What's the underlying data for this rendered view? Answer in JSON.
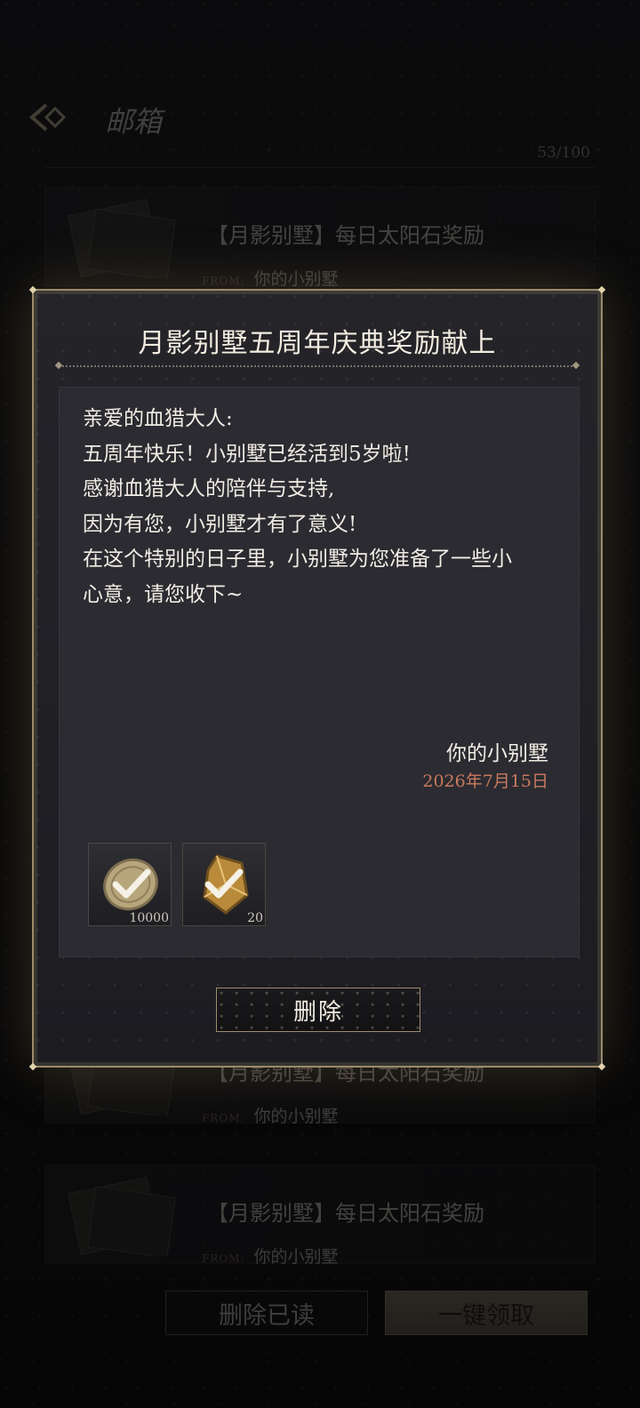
{
  "page": {
    "title": "邮箱",
    "count": "53/100",
    "back_icon": "back-arrow-icon"
  },
  "mail_list": [
    {
      "subject": "【月影别墅】每日太阳石奖励",
      "from_tag": "FROM:",
      "from": "你的小别墅"
    },
    {
      "subject": "【月影别墅】每日太阳石奖励",
      "from_tag": "FROM:",
      "from": "你的小别墅"
    },
    {
      "subject": "【月影别墅】每日太阳石奖励",
      "from_tag": "FROM:",
      "from": "你的小别墅"
    }
  ],
  "bottom_buttons": {
    "delete_read": "删除已读",
    "claim_all": "一键领取"
  },
  "modal": {
    "title": "月影别墅五周年庆典奖励献上",
    "letter_lines": [
      "亲爱的血猎大人:",
      "五周年快乐！小别墅已经活到5岁啦!",
      "感谢血猎大人的陪伴与支持,",
      "因为有您，小别墅才有了意义!",
      "在这个特别的日子里，小别墅为您准备了一些小",
      "心意，请您收下~"
    ],
    "signature": "你的小别墅",
    "date": "2026年7月15日",
    "rewards": [
      {
        "icon": "coin-icon",
        "quantity": "10000",
        "claimed": true
      },
      {
        "icon": "crystal-icon",
        "quantity": "20",
        "claimed": true
      }
    ],
    "delete_button": "删除"
  },
  "colors": {
    "accent_gold": "#9b8b6a",
    "date_color": "#c97a5f"
  }
}
